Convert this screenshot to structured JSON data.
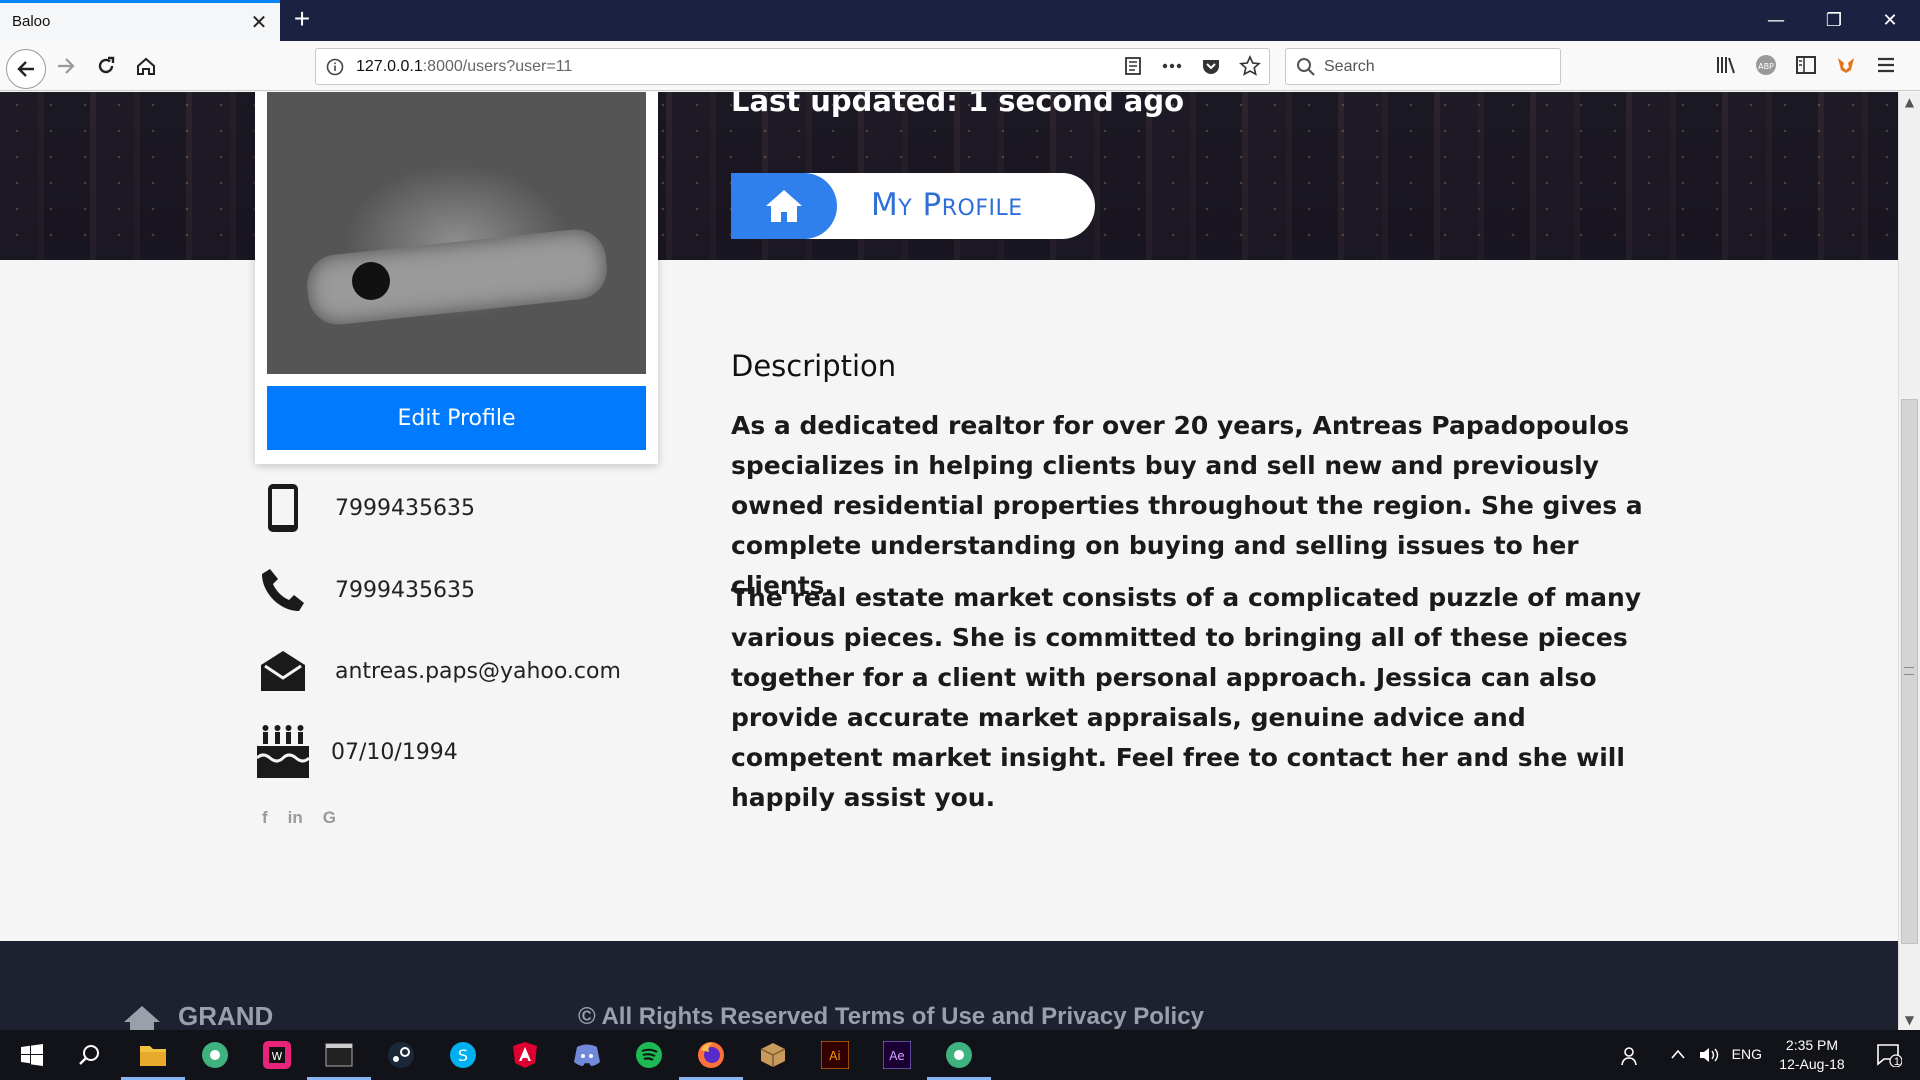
{
  "browser": {
    "tab_title": "Baloo",
    "url_host": "127.0.0.1",
    "url_rest": ":8000/users?user=11",
    "search_placeholder": "Search"
  },
  "profile": {
    "last_updated": "Last updated: 1 second ago",
    "breadcrumb_label": "My Profile",
    "edit_button": "Edit Profile",
    "mobile": "7999435635",
    "phone": "7999435635",
    "email": "antreas.paps@yahoo.com",
    "birthday": "07/10/1994",
    "socials": [
      "f",
      "in",
      "G"
    ]
  },
  "description": {
    "title": "Description",
    "paragraph1": "As a dedicated realtor for over 20 years, Antreas Papadopoulos specializes in helping clients buy and sell new and previously owned residential properties throughout the region. She gives a complete understanding on buying and selling issues to her clients.",
    "paragraph2": "The real estate market consists of a complicated puzzle of many various pieces. She is committed to bringing all of these pieces together for a client with personal approach. Jessica can also provide accurate market appraisals, genuine advice and competent market insight. Feel free to contact her and she will happily assist you."
  },
  "footer": {
    "brand": "GRAND",
    "copyright": "© All Rights Reserved  Terms of Use and Privacy Policy"
  },
  "taskbar": {
    "time": "2:35 PM",
    "date": "12-Aug-18",
    "language": "ENG",
    "notification_count": "1",
    "apps": [
      "file-explorer",
      "chrome-like",
      "webstorm",
      "terminal",
      "steam",
      "skype",
      "angular",
      "discord",
      "spotify",
      "firefox",
      "package",
      "illustrator",
      "after-effects",
      "chrome-like-2"
    ]
  },
  "colors": {
    "primary": "#007bff",
    "pill_blue": "#2f80ed",
    "footer": "#1e2230",
    "titlebar": "#1b2140"
  }
}
